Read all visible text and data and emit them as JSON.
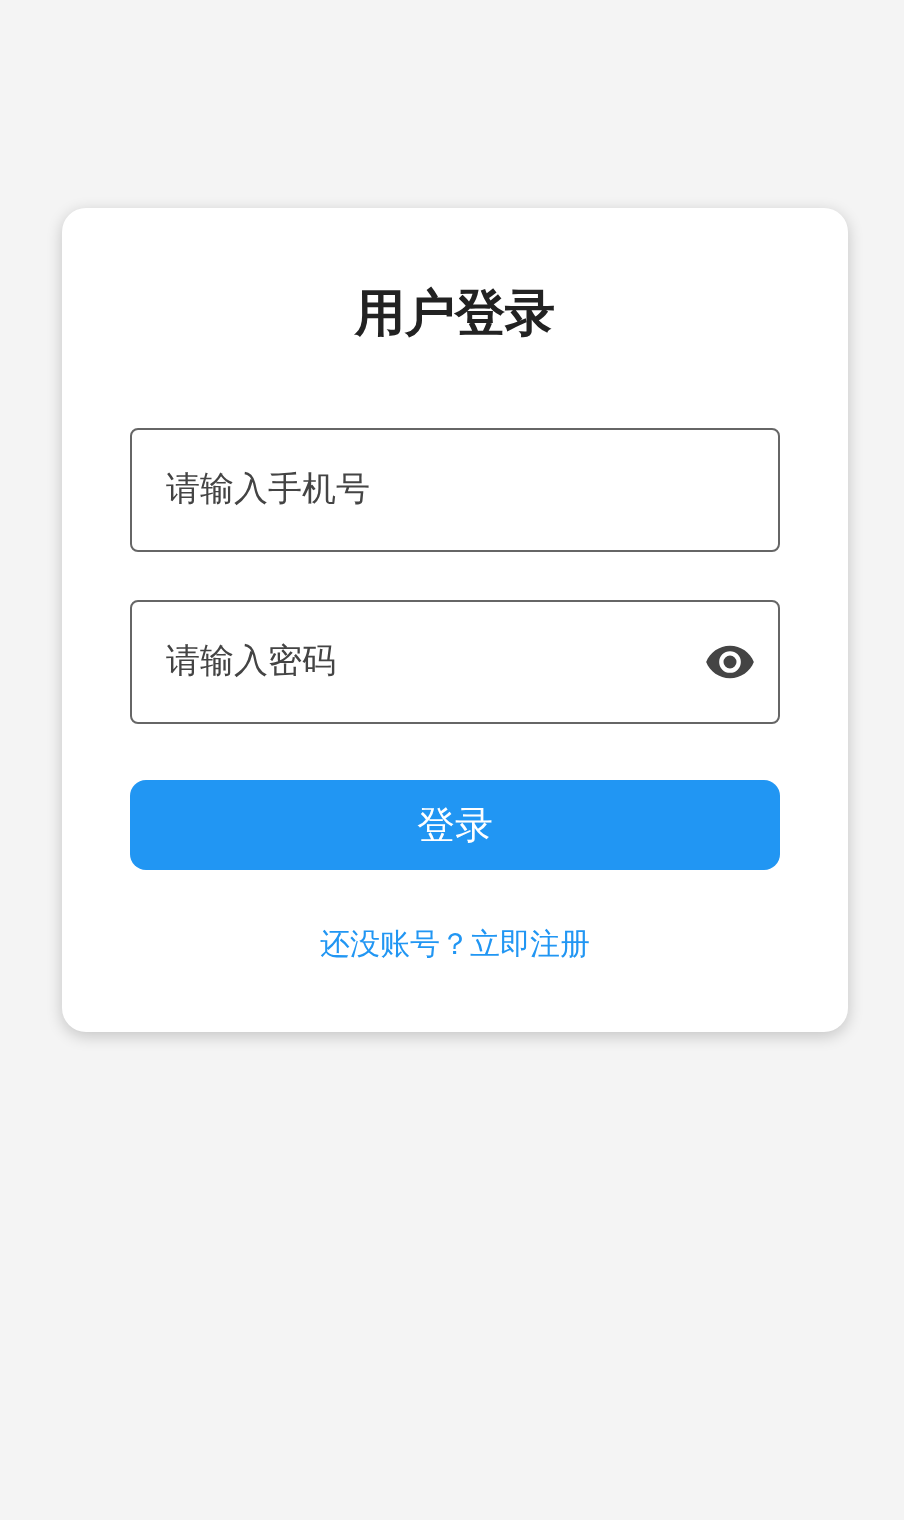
{
  "title": "用户登录",
  "fields": [
    {
      "kind": "text",
      "placeholder": "请输入手机号"
    },
    {
      "kind": "password",
      "placeholder": "请输入密码"
    }
  ],
  "submit": "登录",
  "register_link": "还没账号？立即注册"
}
